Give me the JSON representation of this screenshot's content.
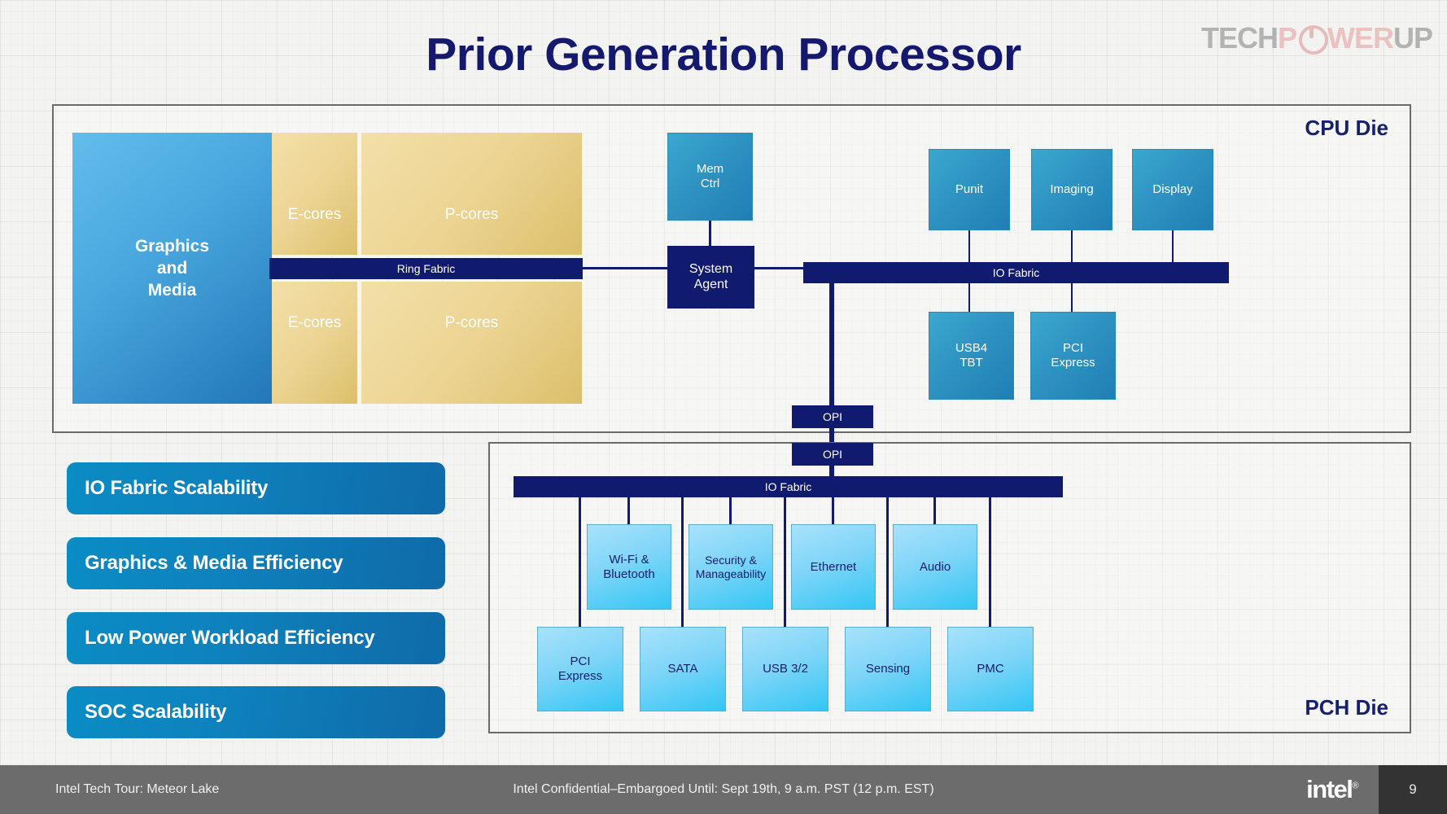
{
  "slide": {
    "title": "Prior Generation Processor",
    "page_number": "9"
  },
  "watermark": {
    "part1": "TECH",
    "part2": "P",
    "part3": "WER",
    "part4": "UP",
    "icon": "power-button-icon"
  },
  "cpu_die": {
    "label": "CPU Die",
    "graphics": "Graphics\nand\nMedia",
    "graphics_lines": [
      "Graphics",
      "and",
      "Media"
    ],
    "cores": [
      {
        "name": "E-cores",
        "position": "top-left"
      },
      {
        "name": "P-cores",
        "position": "top-right"
      },
      {
        "name": "E-cores",
        "position": "bottom-left"
      },
      {
        "name": "P-cores",
        "position": "bottom-right"
      }
    ],
    "ring_fabric": "Ring Fabric",
    "mem_ctrl": "Mem\nCtrl",
    "mem_ctrl_lines": [
      "Mem",
      "Ctrl"
    ],
    "system_agent": "System\nAgent",
    "system_agent_lines": [
      "System",
      "Agent"
    ],
    "io_fabric": "IO Fabric",
    "top_blocks": [
      "Punit",
      "Imaging",
      "Display"
    ],
    "bottom_blocks": [
      "USB4\nTBT",
      "PCI\nExpress"
    ],
    "usb4_lines": [
      "USB4",
      "TBT"
    ],
    "pcie_lines": [
      "PCI",
      "Express"
    ]
  },
  "interconnect": {
    "opi_cpu": "OPI",
    "opi_pch": "OPI"
  },
  "pch_die": {
    "label": "PCH Die",
    "io_fabric": "IO Fabric",
    "top_blocks": [
      {
        "lines": [
          "Wi-Fi &",
          "Bluetooth"
        ]
      },
      {
        "lines": [
          "Security &",
          "Manageability"
        ]
      },
      {
        "lines": [
          "Ethernet"
        ]
      },
      {
        "lines": [
          "Audio"
        ]
      }
    ],
    "bottom_blocks": [
      {
        "lines": [
          "PCI",
          "Express"
        ]
      },
      {
        "lines": [
          "SATA"
        ]
      },
      {
        "lines": [
          "USB 3/2"
        ]
      },
      {
        "lines": [
          "Sensing"
        ]
      },
      {
        "lines": [
          "PMC"
        ]
      }
    ]
  },
  "features": [
    {
      "label": "IO Fabric Scalability"
    },
    {
      "label": "Graphics & Media Efficiency"
    },
    {
      "label": "Low Power Workload Efficiency"
    },
    {
      "label": "SOC Scalability"
    }
  ],
  "footer": {
    "left": "Intel Tech Tour: Meteor Lake",
    "center": "Intel Confidential–Embargoed Until: Sept 19th, 9 a.m. PST (12 p.m. EST)",
    "brand": "intel",
    "brand_mark": "®"
  },
  "colors": {
    "title_navy": "#15196e",
    "fabric_navy": "#101a6e",
    "pill_blue": "#0e82bd",
    "core_gold": "#ecd493",
    "tile_blue": "#2f93c2",
    "tile_cyan": "#7fd5f8",
    "footer_gray": "#6c6c6c"
  }
}
